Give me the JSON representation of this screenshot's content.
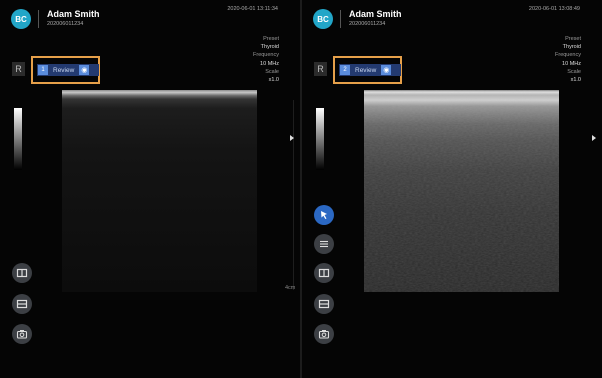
{
  "left_panel": {
    "logo_text": "BC",
    "patient_name": "Adam Smith",
    "patient_id": "202006011234",
    "timestamp": "2020-06-01 13:11:34",
    "info": {
      "preset_label": "Preset",
      "preset_value": "Thyroid",
      "frequency_label": "Frequency",
      "frequency_value": "10 MHz",
      "scale_label": "Scale",
      "scale_value": "x1.0"
    },
    "orientation": "R",
    "review": {
      "number": "1",
      "label": "Review"
    },
    "depth_label": "4cm",
    "tools": [
      "split-view",
      "horizontal-split",
      "camera"
    ]
  },
  "right_panel": {
    "logo_text": "BC",
    "patient_name": "Adam Smith",
    "patient_id": "202006011234",
    "timestamp": "2020-06-01 13:08:49",
    "info": {
      "preset_label": "Preset",
      "preset_value": "Thyroid",
      "frequency_label": "Frequency",
      "frequency_value": "10 MHz",
      "scale_label": "Scale",
      "scale_value": "x1.0"
    },
    "orientation": "R",
    "review": {
      "number": "2",
      "label": "Review"
    },
    "tools": [
      "pointer",
      "menu-list",
      "split-view",
      "horizontal-split",
      "camera"
    ]
  },
  "colors": {
    "accent_frame": "#e6a04a",
    "review_badge": "#233a70",
    "logo": "#22a6c8",
    "active_tool": "#2b68c3"
  }
}
